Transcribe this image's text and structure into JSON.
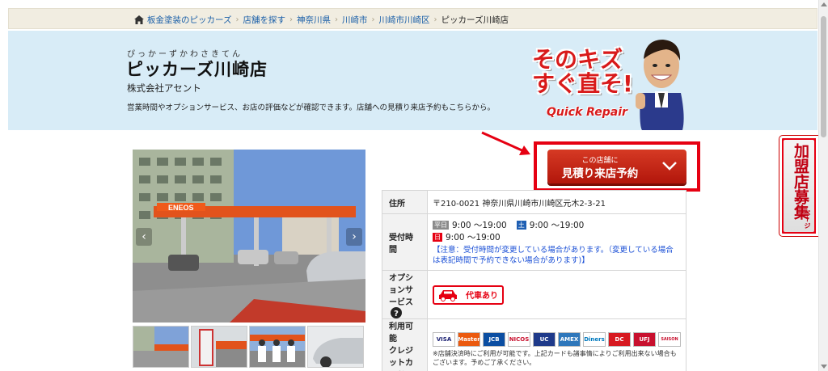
{
  "breadcrumb": {
    "items": [
      "板金塗装のピッカーズ",
      "店舗を探す",
      "神奈川県",
      "川崎市",
      "川崎市川崎区"
    ],
    "current": "ピッカーズ川崎店"
  },
  "hero": {
    "furigana": "ぴっかーずかわさきてん",
    "shop_name": "ピッカーズ川崎店",
    "company": "株式会社アセント",
    "description": "営業時間やオプションサービス、お店の評価などが確認できます。店舗への見積り来店予約もこちらから。"
  },
  "promo": {
    "line1": "そのキズ",
    "line2": "すぐ直そ!",
    "sub": "Quick Repair"
  },
  "reserve_button": {
    "top_label": "この店舗に",
    "main_label": "見積り来店予約"
  },
  "carousel": {
    "prev": "‹",
    "next": "›",
    "station_sign": "ENEOS"
  },
  "info": {
    "address_label": "住所",
    "address_value": "〒210-0021 神奈川県川崎市川崎区元木2-3-21",
    "hours_label": "受付時間",
    "weekday_badge": "平日",
    "weekday_hours": "9:00 ～19:00",
    "saturday_badge": "土",
    "saturday_hours": "9:00 ～19:00",
    "sunday_badge": "日",
    "sunday_hours": "9:00 ～19:00",
    "hours_note": "【注意：受付時間が変更している場合があります。（変更している場合は表記時間で予約できない場合があります)】",
    "option_label": "オプションサービス",
    "option_value": "代車あり",
    "card_label_1": "利用可能",
    "card_label_2": "クレジットカード",
    "cards": [
      "VISA",
      "Master",
      "JCB",
      "NICOS",
      "UC",
      "AMEX",
      "Diners",
      "DC",
      "UFJ",
      "SAISON"
    ],
    "card_note": "※店舗決済時にご利用が可能です。上記カードも諸事情によりご利用出来ない場合もございます。予めご了承ください。"
  },
  "recruit_tab": {
    "label": "加盟店募集",
    "sub": "ページ"
  },
  "colors": {
    "brand_red": "#e60012",
    "link_blue": "#1a5fa8",
    "hero_bg": "#d8ecf7"
  }
}
